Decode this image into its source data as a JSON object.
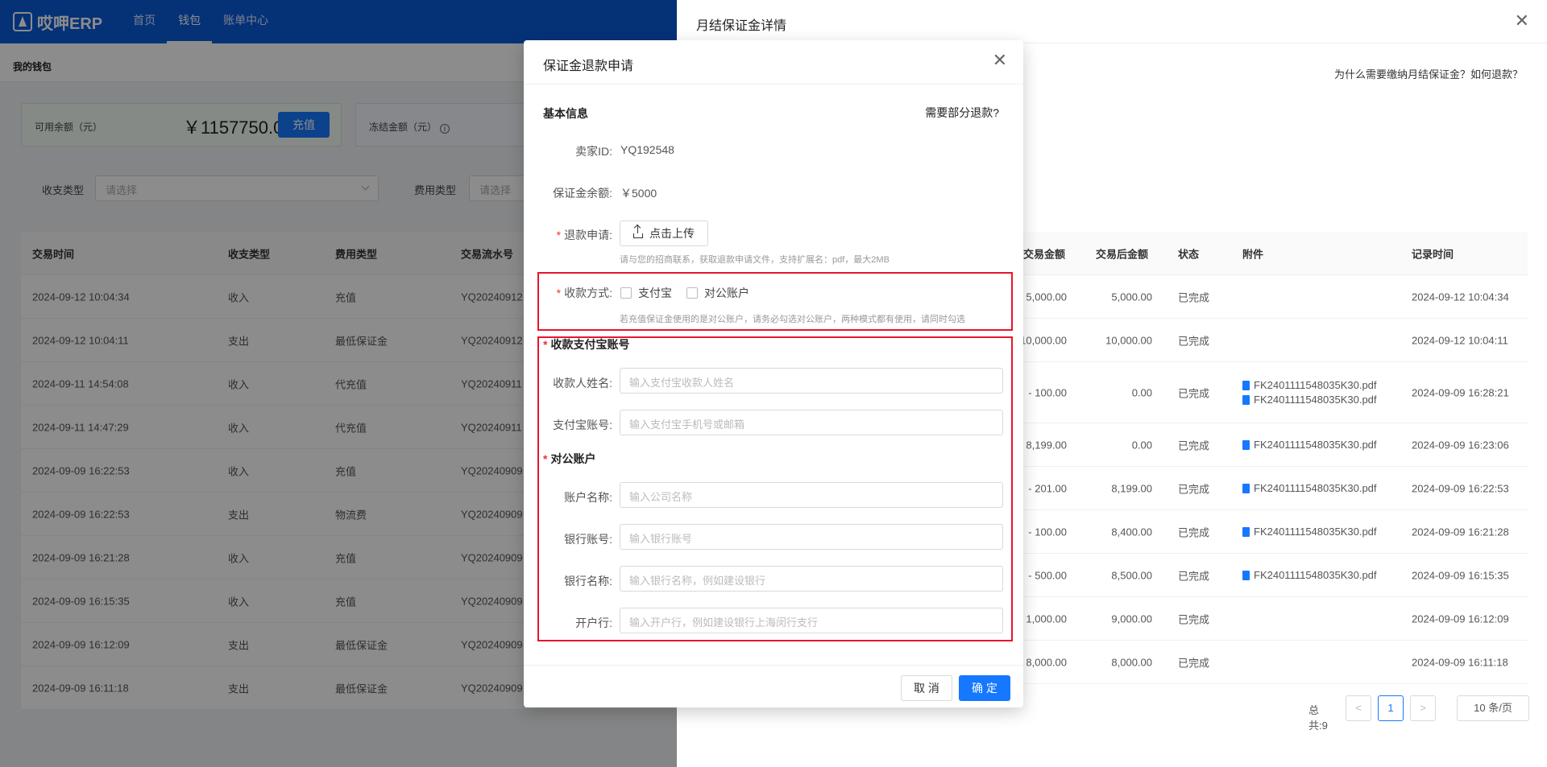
{
  "app": {
    "logo": "哎呷ERP",
    "nav": [
      "首页",
      "钱包",
      "账单中心"
    ],
    "active_nav": "钱包",
    "breadcrumb": "我的钱包"
  },
  "wallet": {
    "available_label": "可用余额（元）",
    "available_value": "￥1157750.00",
    "recharge_button": "充值",
    "frozen_label": "冻结金额（元）"
  },
  "filters": {
    "type_label": "收支类型",
    "type_placeholder": "请选择",
    "fee_label": "费用类型",
    "fee_placeholder": "请选择"
  },
  "left_table": {
    "headers": [
      "交易时间",
      "收支类型",
      "费用类型",
      "交易流水号"
    ],
    "rows": [
      [
        "2024-09-12 10:04:34",
        "收入",
        "充值",
        "YQ20240912"
      ],
      [
        "2024-09-12 10:04:11",
        "支出",
        "最低保证金",
        "YQ20240912"
      ],
      [
        "2024-09-11 14:54:08",
        "收入",
        "代充值",
        "YQ20240911"
      ],
      [
        "2024-09-11 14:47:29",
        "收入",
        "代充值",
        "YQ20240911"
      ],
      [
        "2024-09-09 16:22:53",
        "收入",
        "充值",
        "YQ20240909"
      ],
      [
        "2024-09-09 16:22:53",
        "支出",
        "物流费",
        "YQ20240909"
      ],
      [
        "2024-09-09 16:21:28",
        "收入",
        "充值",
        "YQ20240909"
      ],
      [
        "2024-09-09 16:15:35",
        "收入",
        "充值",
        "YQ20240909"
      ],
      [
        "2024-09-09 16:12:09",
        "支出",
        "最低保证金",
        "YQ20240909"
      ],
      [
        "2024-09-09 16:11:18",
        "支出",
        "最低保证金",
        "YQ20240909"
      ]
    ]
  },
  "drawer": {
    "title": "月结保证金详情",
    "help_link": "为什么需要缴纳月结保证金？如何退款？",
    "headers": [
      "交易金额",
      "交易后金额",
      "状态",
      "附件",
      "记录时间"
    ],
    "rows": [
      {
        "amount": "5,000.00",
        "after": "5,000.00",
        "status": "已完成",
        "files": [],
        "time": "2024-09-12 10:04:34"
      },
      {
        "amount": "10,000.00",
        "after": "10,000.00",
        "status": "已完成",
        "files": [],
        "time": "2024-09-12 10:04:11"
      },
      {
        "amount": "- 100.00",
        "after": "0.00",
        "status": "已完成",
        "files": [
          "FK2401111548035K30.pdf",
          "FK2401111548035K30.pdf"
        ],
        "time": "2024-09-09 16:28:21"
      },
      {
        "amount": "8,199.00",
        "after": "0.00",
        "status": "已完成",
        "files": [
          "FK2401111548035K30.pdf"
        ],
        "time": "2024-09-09 16:23:06"
      },
      {
        "amount": "- 201.00",
        "after": "8,199.00",
        "status": "已完成",
        "files": [
          "FK2401111548035K30.pdf"
        ],
        "time": "2024-09-09 16:22:53"
      },
      {
        "amount": "- 100.00",
        "after": "8,400.00",
        "status": "已完成",
        "files": [
          "FK2401111548035K30.pdf"
        ],
        "time": "2024-09-09 16:21:28"
      },
      {
        "amount": "- 500.00",
        "after": "8,500.00",
        "status": "已完成",
        "files": [
          "FK2401111548035K30.pdf"
        ],
        "time": "2024-09-09 16:15:35"
      },
      {
        "amount": "1,000.00",
        "after": "9,000.00",
        "status": "已完成",
        "files": [],
        "time": "2024-09-09 16:12:09"
      },
      {
        "amount": "8,000.00",
        "after": "8,000.00",
        "status": "已完成",
        "files": [],
        "time": "2024-09-09 16:11:18"
      }
    ],
    "pager": {
      "total": "总共:9",
      "prev": "<",
      "current": "1",
      "next": ">",
      "page_size": "10 条/页"
    }
  },
  "modal": {
    "title": "保证金退款申请",
    "section_basic": "基本信息",
    "partial_refund_link": "需要部分退款?",
    "seller_id_label": "卖家ID:",
    "seller_id_value": "YQ192548",
    "balance_label": "保证金余额:",
    "balance_value": "￥5000",
    "refund_apply_label": "退款申请:",
    "upload_button": "点击上传",
    "upload_hint": "请与您的招商联系，获取退款申请文件，支持扩展名：pdf，最大2MB",
    "payment_method_label": "收款方式:",
    "payment_options": [
      "支付宝",
      "对公账户"
    ],
    "payment_hint": "若充值保证金使用的是对公账户，请务必勾选对公账户，两种模式都有使用，请同时勾选",
    "section_alipay": "收款支付宝账号",
    "payee_name_label": "收款人姓名:",
    "payee_name_placeholder": "输入支付宝收款人姓名",
    "alipay_account_label": "支付宝账号:",
    "alipay_account_placeholder": "输入支付宝手机号或邮箱",
    "section_corporate": "对公账户",
    "account_name_label": "账户名称:",
    "account_name_placeholder": "输入公司名称",
    "bank_account_label": "银行账号:",
    "bank_account_placeholder": "输入银行账号",
    "bank_name_label": "银行名称:",
    "bank_name_placeholder": "输入银行名称，例如建设银行",
    "branch_label": "开户行:",
    "branch_placeholder": "输入开户行，例如建设银行上海闵行支行",
    "cancel_button": "取 消",
    "ok_button": "确 定"
  },
  "colors": {
    "primary": "#1677ff",
    "header": "#0a5bd9",
    "highlight": "#e8152a"
  }
}
